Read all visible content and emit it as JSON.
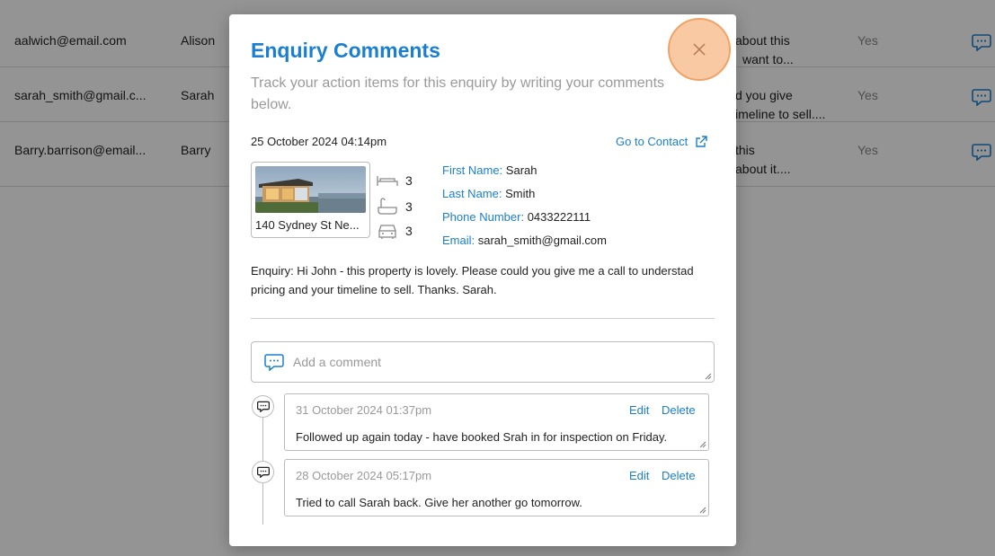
{
  "background_table": {
    "rows": [
      {
        "email": "aalwich@email.com",
        "name": "Alison",
        "enquiry_line1": "about this",
        "enquiry_line2": "want to...",
        "responded": "Yes"
      },
      {
        "email": "sarah_smith@gmail.c...",
        "name": "Sarah",
        "enquiry_line1": "d you give",
        "enquiry_line2": "imeline to sell....",
        "responded": "Yes"
      },
      {
        "email": "Barry.barrison@email...",
        "name": "Barry",
        "enquiry_line1": "this",
        "enquiry_line2": "about it....",
        "responded": "Yes"
      }
    ]
  },
  "modal": {
    "title": "Enquiry Comments",
    "subtitle": "Track your action items for this enquiry by writing your comments below.",
    "close_icon": "close-icon",
    "date": "25 October 2024 04:14pm",
    "goto_contact": "Go to Contact",
    "property": {
      "address": "140 Sydney St Ne...",
      "bedrooms": "3",
      "bathrooms": "3",
      "parking": "3"
    },
    "contact": {
      "first_name_label": "First Name:",
      "first_name": "Sarah",
      "last_name_label": "Last Name:",
      "last_name": "Smith",
      "phone_label": "Phone Number:",
      "phone": "0433222111",
      "email_label": "Email:",
      "email": "sarah_smith@gmail.com"
    },
    "enquiry_text": "Enquiry: Hi John - this property is lovely. Please could you give me a call to understad pricing and your timeline to sell. Thanks. Sarah.",
    "add_comment_placeholder": "Add a comment",
    "comments": [
      {
        "date": "31 October 2024 01:37pm",
        "edit": "Edit",
        "delete": "Delete",
        "text": "Followed up again today - have booked Srah in for inspection on Friday."
      },
      {
        "date": "28 October 2024 05:17pm",
        "edit": "Edit",
        "delete": "Delete",
        "text": "Tried to call Sarah back. Give her another go tomorrow."
      }
    ]
  },
  "colors": {
    "accent": "#1a7fd0",
    "close_highlight": "#f8c9a3"
  }
}
